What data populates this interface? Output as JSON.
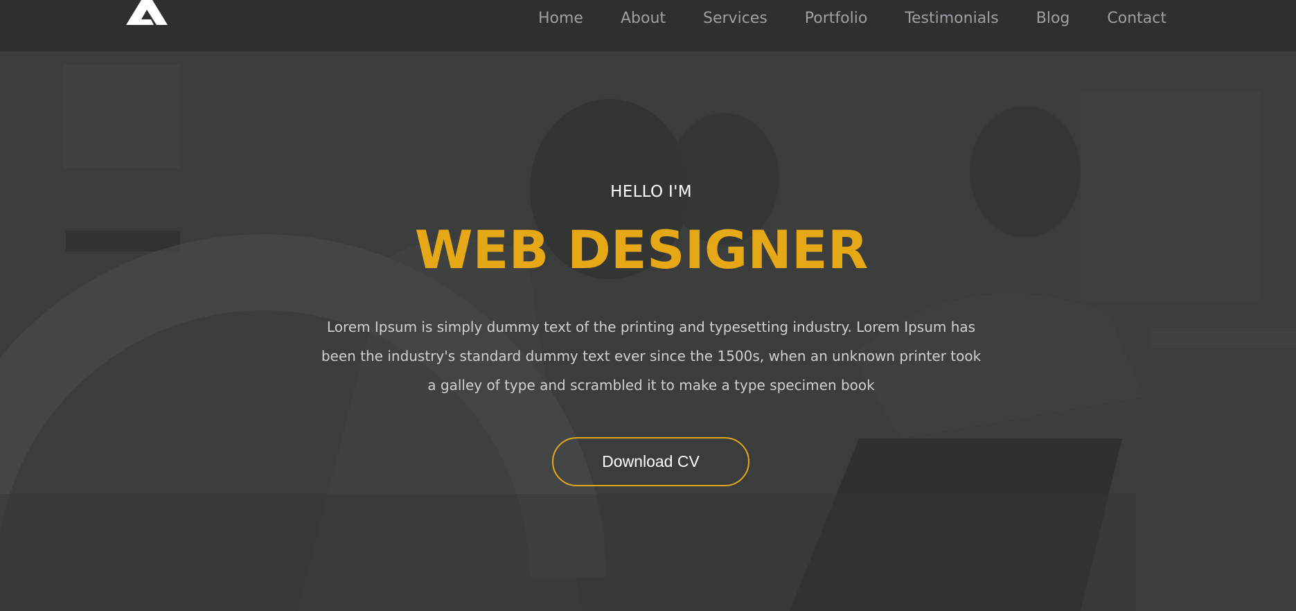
{
  "nav": {
    "items": [
      {
        "label": "Home"
      },
      {
        "label": "About"
      },
      {
        "label": "Services"
      },
      {
        "label": "Portfolio"
      },
      {
        "label": "Testimonials"
      },
      {
        "label": "Blog"
      },
      {
        "label": "Contact"
      }
    ]
  },
  "hero": {
    "greeting": "HELLO I'M",
    "headline": "WEB DESIGNER",
    "description": "Lorem Ipsum is simply dummy text of the printing and typesetting industry. Lorem Ipsum has been the industry's standard dummy text ever since the 1500s, when an unknown printer took a galley of type and scrambled it to make a type specimen book",
    "cta_label": "Download CV"
  },
  "colors": {
    "accent": "#e6a817",
    "navbar_bg": "#2e2f2f",
    "hero_bg": "#3b3c3c",
    "nav_text": "#9ea0a6"
  },
  "icons": {
    "logo": "triangle-a-logo"
  }
}
